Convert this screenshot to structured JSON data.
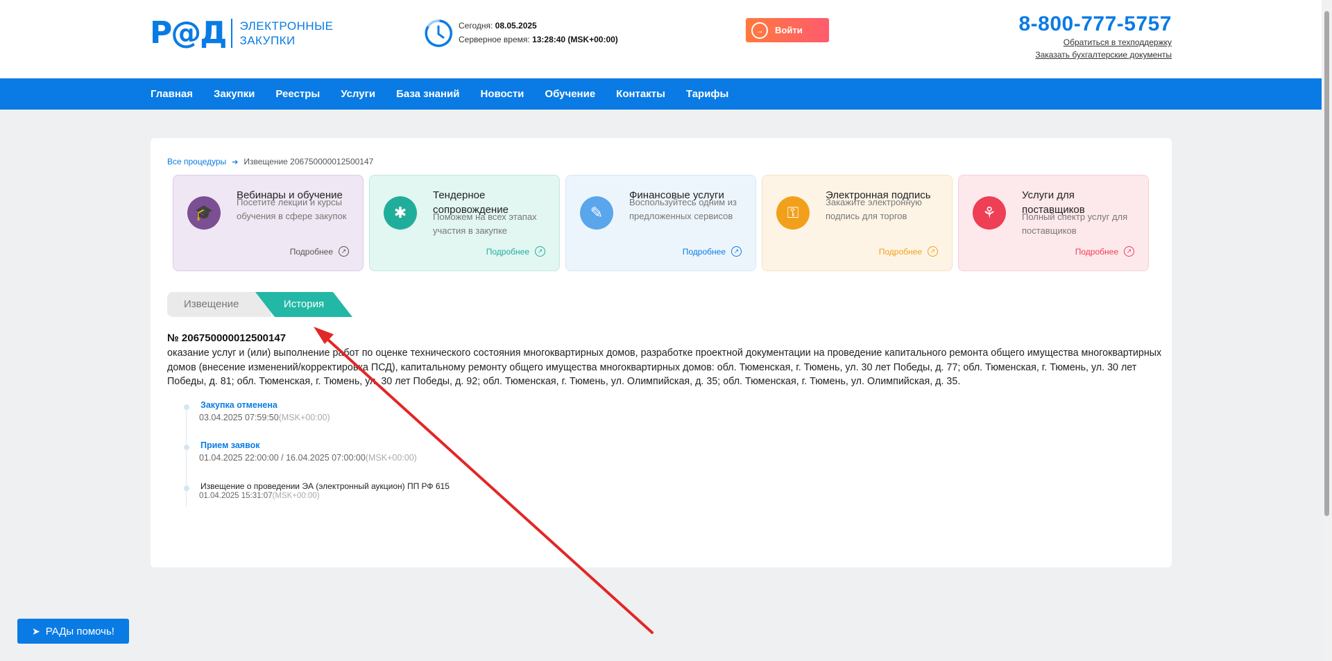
{
  "header": {
    "logo_mark": "Р@Д",
    "logo_line1": "ЭЛЕКТРОННЫЕ",
    "logo_line2": "ЗАКУПКИ",
    "today_label": "Сегодня:",
    "today_value": "08.05.2025",
    "server_label": "Серверное время:",
    "server_value": "13:28:40 (MSK+00:00)",
    "login_label": "Войти",
    "phone": "8-800-777-5757",
    "support_link": "Обратиться в техподдержку",
    "docs_link": "Заказать бухгалтерские документы"
  },
  "nav": [
    "Главная",
    "Закупки",
    "Реестры",
    "Услуги",
    "База знаний",
    "Новости",
    "Обучение",
    "Контакты",
    "Тарифы"
  ],
  "breadcrumb": {
    "root": "Все процедуры",
    "current": "Извещение 206750000012500147"
  },
  "services": [
    {
      "title": "Вебинары и обучение",
      "desc": "Посетите лекции и курсы обучения в сфере закупок",
      "more": "Подробнее",
      "bg": "#efe7f3",
      "border": "#dccbe6",
      "accent": "#7a4f93",
      "moreColor": "#555555",
      "icon": "graduation-cap-icon"
    },
    {
      "title": "Тендерное сопровождение",
      "desc": "Поможем на всех этапах участия в закупке",
      "more": "Подробнее",
      "bg": "#e2f6f2",
      "border": "#bfe9e1",
      "accent": "#20ae9b",
      "moreColor": "#20ae9b",
      "icon": "support-icon"
    },
    {
      "title": "Финансовые услуги",
      "desc": "Воспользуйтесь одним из предложенных сервисов",
      "more": "Подробнее",
      "bg": "#edf5fc",
      "border": "#d6e8f7",
      "accent": "#5aa6ec",
      "moreColor": "#0a7be4",
      "icon": "finance-icon"
    },
    {
      "title": "Электронная подпись",
      "desc": "Закажите электронную подпись для торгов",
      "more": "Подробнее",
      "bg": "#fef4e6",
      "border": "#f8e0bf",
      "accent": "#f2a01c",
      "moreColor": "#f2a01c",
      "icon": "key-icon"
    },
    {
      "title": "Услуги для поставщиков",
      "desc": "Полный спектр услуг для поставщиков",
      "more": "Подробнее",
      "bg": "#fde9ec",
      "border": "#f6cdd3",
      "accent": "#ee3f55",
      "moreColor": "#ee3f55",
      "icon": "share-icon"
    }
  ],
  "tabs": {
    "notice": "Извещение",
    "history": "История"
  },
  "notice": {
    "number": "№ 206750000012500147",
    "description": "оказание услуг и (или) выполнение работ по оценке технического состояния многоквартирных домов, разработке проектной документации на проведение капитального ремонта общего имущества многоквартирных домов (внесение изменений/корректировка ПСД), капитальному ремонту общего имущества многоквартирных домов: обл. Тюменская, г. Тюмень, ул. 30 лет Победы, д. 77; обл. Тюменская, г. Тюмень, ул. 30 лет Победы, д. 81; обл. Тюменская, г. Тюмень, ул. 30 лет Победы, д. 92; обл. Тюменская, г. Тюмень, ул. Олимпийская, д. 35; обл. Тюменская, г. Тюмень, ул. Олимпийская, д. 35."
  },
  "history": [
    {
      "title": "Закупка отменена",
      "date": "03.04.2025 07:59:50",
      "tz": "(MSK+00:00)"
    },
    {
      "title": "Прием заявок",
      "date": "01.04.2025 22:00:00 / 16.04.2025 07:00:00",
      "tz": "(MSK+00:00)"
    },
    {
      "title": "Извещение о проведении ЭА (электронный аукцион) ПП РФ 615",
      "date": "01.04.2025 15:31:07",
      "tz": "(MSK+00:00)"
    }
  ],
  "help_button": "РАДы помочь!",
  "colors": {
    "brand": "#0a7be4",
    "accent_tab": "#23b8a5",
    "annotation_arrow": "#e32626"
  }
}
